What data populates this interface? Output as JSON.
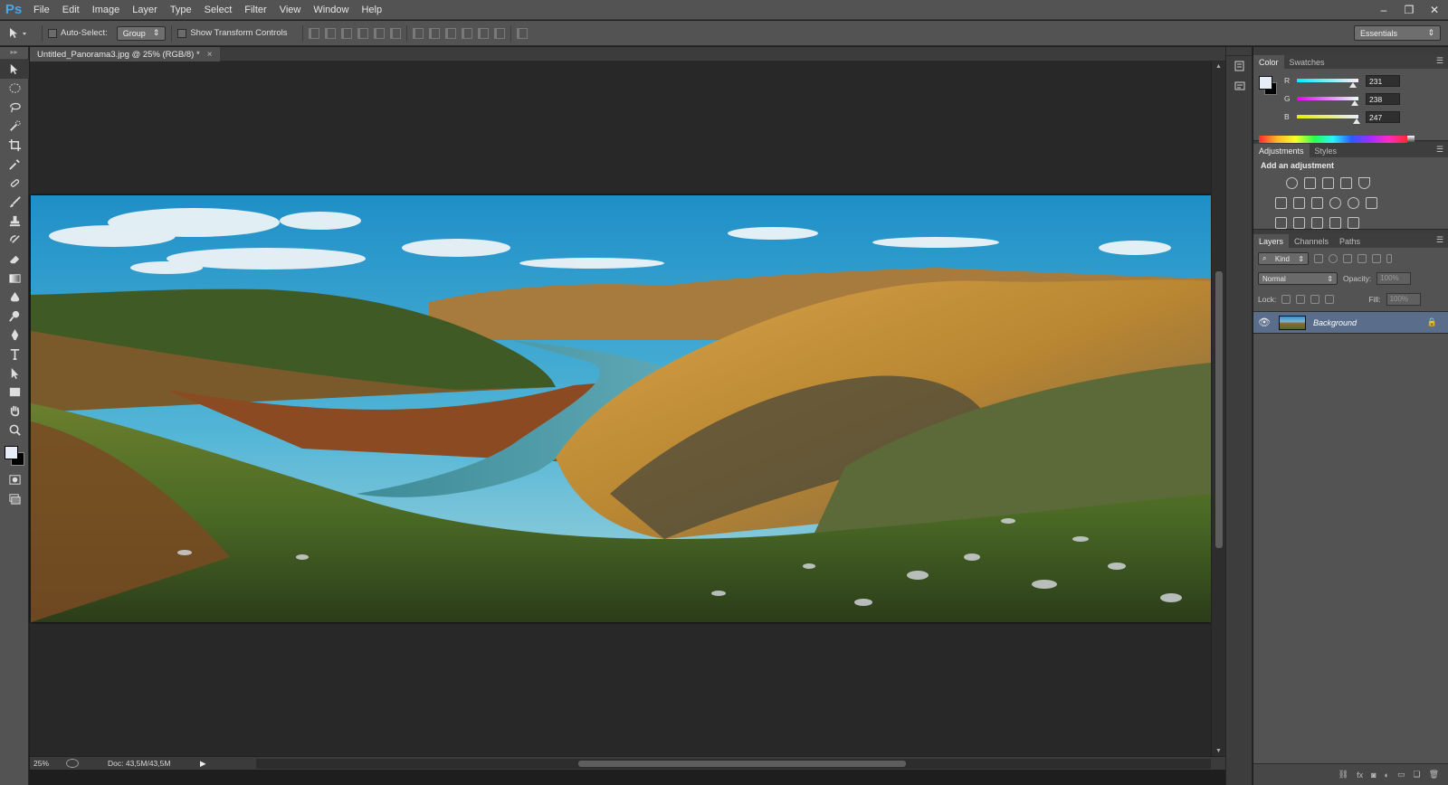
{
  "app": {
    "logo": "Ps"
  },
  "menu": [
    "File",
    "Edit",
    "Image",
    "Layer",
    "Type",
    "Select",
    "Filter",
    "View",
    "Window",
    "Help"
  ],
  "window_controls": {
    "minimize": "–",
    "restore": "❐",
    "close": "✕"
  },
  "options_bar": {
    "auto_select_label": "Auto-Select:",
    "auto_select_value": "Group",
    "transform_label": "Show Transform Controls",
    "workspace": "Essentials"
  },
  "document": {
    "tab_title": "Untitled_Panorama3.jpg @ 25% (RGB/8) *",
    "close": "×"
  },
  "status": {
    "zoom": "25%",
    "doc_size": "Doc: 43,5M/43,5M",
    "arrow": "▶"
  },
  "tools": [
    "move-icon",
    "marquee-icon",
    "lasso-icon",
    "quick-select-icon",
    "crop-icon",
    "eyedropper-icon",
    "healing-brush-icon",
    "brush-icon",
    "clone-stamp-icon",
    "history-brush-icon",
    "eraser-icon",
    "gradient-icon",
    "blur-icon",
    "dodge-icon",
    "pen-icon",
    "type-icon",
    "path-select-icon",
    "rectangle-icon",
    "hand-icon",
    "zoom-icon"
  ],
  "colors": {
    "foreground": "#e7eef7",
    "background": "#000000",
    "selected_layer": "#5a6e8c"
  },
  "color_panel": {
    "tabs": [
      "Color",
      "Swatches"
    ],
    "channels": [
      {
        "label": "R",
        "value": "231"
      },
      {
        "label": "G",
        "value": "238"
      },
      {
        "label": "B",
        "value": "247"
      }
    ]
  },
  "adjustments_panel": {
    "tabs": [
      "Adjustments",
      "Styles"
    ],
    "title": "Add an adjustment"
  },
  "layers_panel": {
    "tabs": [
      "Layers",
      "Channels",
      "Paths"
    ],
    "filter_kind": "Kind",
    "blend_mode": "Normal",
    "opacity_label": "Opacity:",
    "opacity_value": "100%",
    "lock_label": "Lock:",
    "fill_label": "Fill:",
    "fill_value": "100%",
    "layers": [
      {
        "name": "Background",
        "visible": true,
        "locked": true
      }
    ],
    "footer_icons": [
      "link-icon",
      "fx-icon",
      "mask-icon",
      "adjustment-layer-icon",
      "group-icon",
      "new-layer-icon",
      "trash-icon"
    ],
    "footer_fx": "fx"
  }
}
